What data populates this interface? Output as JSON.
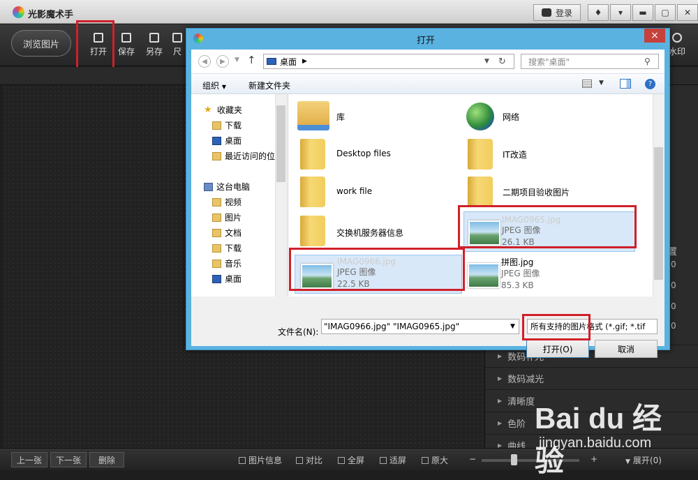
{
  "app": {
    "title": "光影魔术手",
    "login": "登录",
    "browse_button": "浏览图片",
    "tools": [
      {
        "label": "打开"
      },
      {
        "label": "保存"
      },
      {
        "label": "另存"
      },
      {
        "label": "尺"
      }
    ],
    "right_tool_label": "水印",
    "right_panel": {
      "partial_label": "置",
      "partial_values": [
        "0",
        "0",
        "0",
        "0"
      ],
      "items": [
        {
          "label": "数码补光"
        },
        {
          "label": "数码减光"
        },
        {
          "label": "清晰度"
        },
        {
          "label": "色阶"
        },
        {
          "label": "曲线"
        }
      ]
    },
    "bottom": {
      "prev": "上一张",
      "next": "下一张",
      "delete": "删除",
      "info": "图片信息",
      "compare": "对比",
      "fullscreen": "全屏",
      "fit": "适屏",
      "original": "原大",
      "minus": "−",
      "plus": "+",
      "expand": "展开(0)"
    }
  },
  "dialog": {
    "title": "打开",
    "close": "×",
    "address": "桌面",
    "search_placeholder": "搜索\"桌面\"",
    "organize": "组织",
    "new_folder": "新建文件夹",
    "nav": {
      "favorites": "收藏夹",
      "fav_items": [
        "下载",
        "桌面",
        "最近访问的位"
      ],
      "this_pc": "这台电脑",
      "pc_items": [
        "视频",
        "图片",
        "文档",
        "下载",
        "音乐",
        "桌面"
      ]
    },
    "files": [
      {
        "name": "库",
        "type": "library"
      },
      {
        "name": "网络",
        "type": "network"
      },
      {
        "name": "Desktop files",
        "type": "folder"
      },
      {
        "name": "IT改造",
        "type": "folder"
      },
      {
        "name": "work file",
        "type": "folder"
      },
      {
        "name": "二期项目验收图片",
        "type": "folder"
      },
      {
        "name": "交换机服务器信息",
        "type": "folder"
      },
      {
        "name": "IMAG0965.jpg",
        "kind": "JPEG 图像",
        "size": "26.1 KB",
        "type": "image",
        "selected": true
      },
      {
        "name": "IMAG0966.jpg",
        "kind": "JPEG 图像",
        "size": "22.5 KB",
        "type": "image",
        "selected": true
      },
      {
        "name": "拼图.jpg",
        "kind": "JPEG 图像",
        "size": "85.3 KB",
        "type": "image",
        "selected": false
      }
    ],
    "filename_label": "文件名(N):",
    "filename_value": "\"IMAG0966.jpg\" \"IMAG0965.jpg\"",
    "filetype_value": "所有支持的图片格式 (*.gif; *.tif",
    "open_button": "打开(O)",
    "cancel_button": "取消"
  },
  "watermark": {
    "main": "Bai du 经验",
    "sub": "jingyan.baidu.com"
  },
  "colors": {
    "annotation_red": "#d0202a",
    "dialog_frame": "#5ab2e0",
    "selection_bg": "#d8e8f8"
  }
}
